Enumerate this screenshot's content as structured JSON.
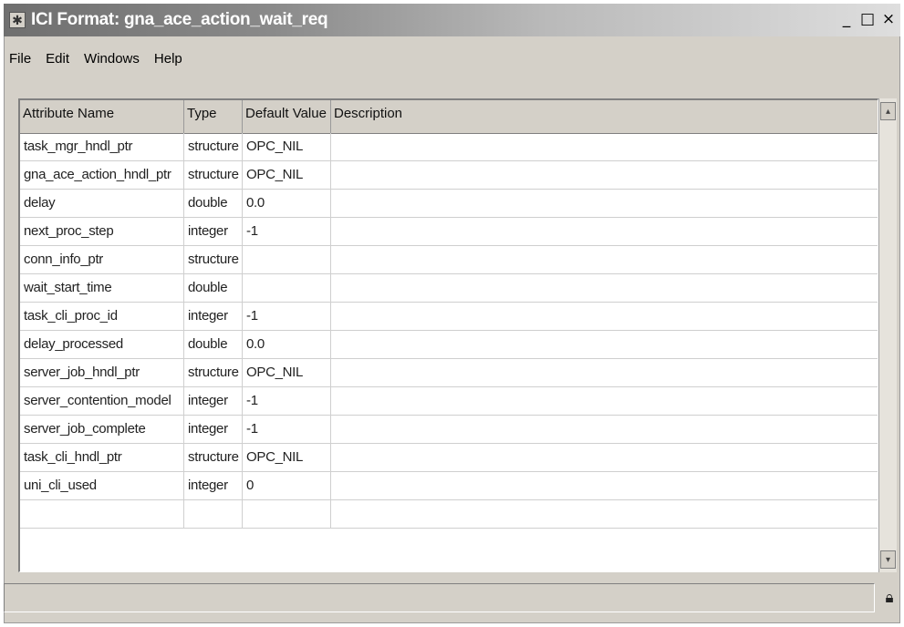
{
  "window": {
    "title": "ICI Format: gna_ace_action_wait_req",
    "system_icon": "star-icon",
    "minimize_glyph": "_",
    "maximize_glyph": "□",
    "close_glyph": "×"
  },
  "menu": [
    {
      "label": "File"
    },
    {
      "label": "Edit"
    },
    {
      "label": "Windows"
    },
    {
      "label": "Help"
    }
  ],
  "table": {
    "columns": [
      "Attribute Name",
      "Type",
      "Default Value",
      "Description"
    ],
    "rows": [
      {
        "name": "task_mgr_hndl_ptr",
        "type": "structure",
        "default": "OPC_NIL",
        "description": ""
      },
      {
        "name": "gna_ace_action_hndl_ptr",
        "type": "structure",
        "default": "OPC_NIL",
        "description": ""
      },
      {
        "name": "delay",
        "type": "double",
        "default": "0.0",
        "description": ""
      },
      {
        "name": "next_proc_step",
        "type": "integer",
        "default": "-1",
        "description": ""
      },
      {
        "name": "conn_info_ptr",
        "type": "structure",
        "default": "",
        "description": ""
      },
      {
        "name": "wait_start_time",
        "type": "double",
        "default": "",
        "description": ""
      },
      {
        "name": "task_cli_proc_id",
        "type": "integer",
        "default": "-1",
        "description": ""
      },
      {
        "name": "delay_processed",
        "type": "double",
        "default": "0.0",
        "description": ""
      },
      {
        "name": "server_job_hndl_ptr",
        "type": "structure",
        "default": "OPC_NIL",
        "description": ""
      },
      {
        "name": "server_contention_model",
        "type": "integer",
        "default": "-1",
        "description": ""
      },
      {
        "name": "server_job_complete",
        "type": "integer",
        "default": "-1",
        "description": ""
      },
      {
        "name": "task_cli_hndl_ptr",
        "type": "structure",
        "default": "OPC_NIL",
        "description": ""
      },
      {
        "name": "uni_cli_used",
        "type": "integer",
        "default": "0",
        "description": ""
      },
      {
        "name": "",
        "type": "",
        "default": "",
        "description": ""
      }
    ]
  },
  "scrollbar": {
    "up_glyph": "▴",
    "down_glyph": "▾"
  },
  "status": {
    "icon": "lock-icon"
  }
}
